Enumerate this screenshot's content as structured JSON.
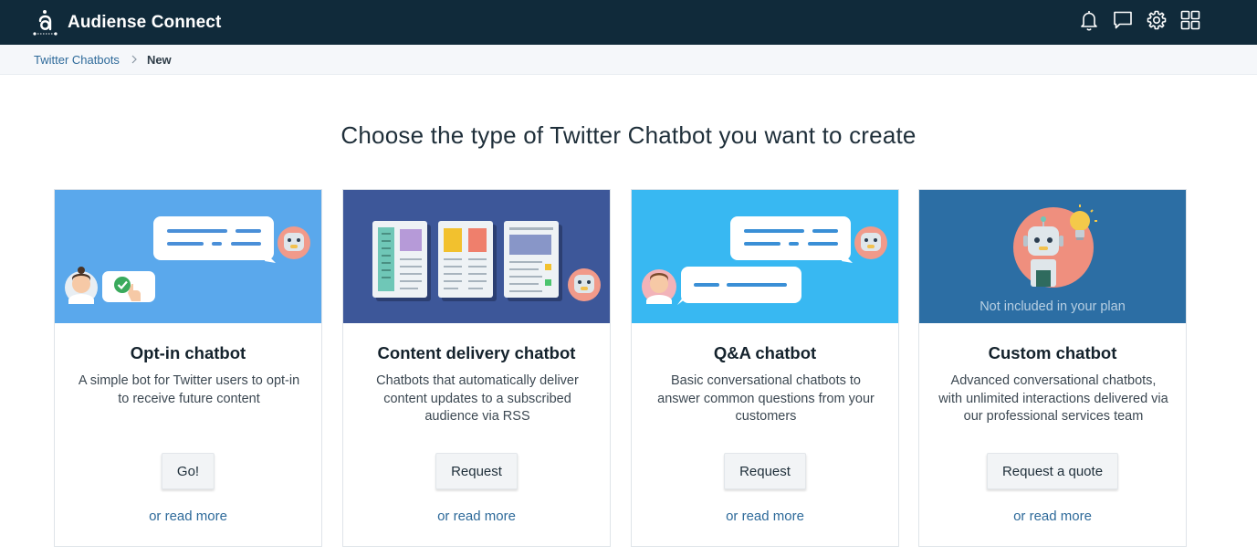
{
  "app": {
    "name": "Audiense Connect",
    "logo_icon": "audiense-logo-icon",
    "colors": {
      "topbar": "#102a3a",
      "link": "#2e6a9a"
    }
  },
  "header_icons": [
    "bell-icon",
    "chat-icon",
    "gear-icon",
    "apps-grid-icon"
  ],
  "breadcrumb": {
    "parent": "Twitter Chatbots",
    "current": "New"
  },
  "page": {
    "title": "Choose the type of Twitter Chatbot you want to create"
  },
  "cards": [
    {
      "title": "Opt-in chatbot",
      "description": "A simple bot for Twitter users to opt-in to receive future content",
      "button": "Go!",
      "link": "or read more",
      "media_color": "#5aa8ec"
    },
    {
      "title": "Content delivery chatbot",
      "description": "Chatbots that automatically deliver content updates to a subscribed audience via RSS",
      "button": "Request",
      "link": "or read more",
      "media_color": "#3d5799"
    },
    {
      "title": "Q&A chatbot",
      "description": "Basic conversational chatbots to answer common questions from your customers",
      "button": "Request",
      "link": "or read more",
      "media_color": "#38b8f2"
    },
    {
      "title": "Custom chatbot",
      "description": "Advanced conversational chatbots, with unlimited interactions delivered via our professional services team",
      "button": "Request a quote",
      "link": "or read more",
      "media_color": "#2c6ea4",
      "badge": "Not included in your plan"
    }
  ]
}
